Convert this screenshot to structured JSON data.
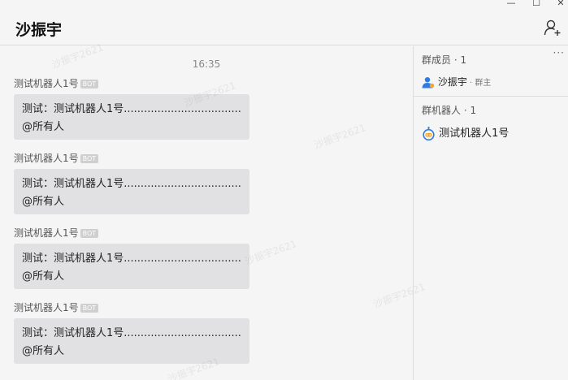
{
  "window": {
    "minimize": "—",
    "maximize": "☐",
    "close": "✕"
  },
  "header": {
    "title": "沙振宇"
  },
  "chat": {
    "timestamp": "16:35",
    "messages": [
      {
        "sender": "测试机器人1号",
        "badge": "BOT",
        "line1": "测试：测试机器人1号....................................!",
        "line2": "@所有人"
      },
      {
        "sender": "测试机器人1号",
        "badge": "BOT",
        "line1": "测试：测试机器人1号....................................!",
        "line2": "@所有人"
      },
      {
        "sender": "测试机器人1号",
        "badge": "BOT",
        "line1": "测试：测试机器人1号....................................!",
        "line2": "@所有人"
      },
      {
        "sender": "测试机器人1号",
        "badge": "BOT",
        "line1": "测试：测试机器人1号....................................!",
        "line2": "@所有人"
      }
    ]
  },
  "sidebar": {
    "members_title": "群成员 · 1",
    "more": "···",
    "member": {
      "name": "沙振宇",
      "role": " · 群主"
    },
    "robots_title": "群机器人 · 1",
    "robot": {
      "name": "测试机器人1号"
    }
  },
  "watermark": "沙振宇2621",
  "colors": {
    "accent": "#2d7be5",
    "bubble": "#e1e1e4",
    "background": "#f5f5f5"
  }
}
